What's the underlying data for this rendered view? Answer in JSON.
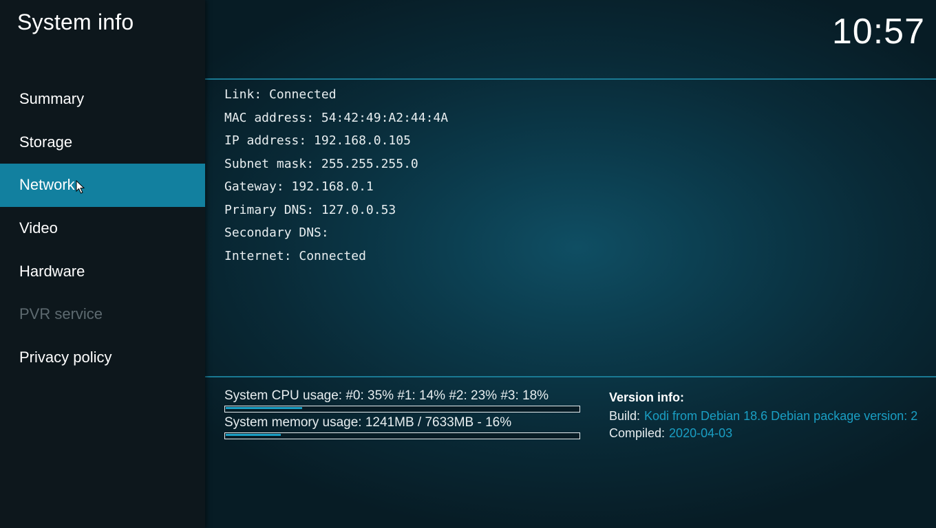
{
  "header": {
    "title": "System info",
    "clock": "10:57"
  },
  "sidebar": {
    "items": [
      {
        "label": "Summary",
        "state": "normal"
      },
      {
        "label": "Storage",
        "state": "normal"
      },
      {
        "label": "Network",
        "state": "active"
      },
      {
        "label": "Video",
        "state": "normal"
      },
      {
        "label": "Hardware",
        "state": "normal"
      },
      {
        "label": "PVR service",
        "state": "disabled"
      },
      {
        "label": "Privacy policy",
        "state": "normal"
      }
    ]
  },
  "network": {
    "rows": [
      "Link: Connected",
      "MAC address: 54:42:49:A2:44:4A",
      "IP address: 192.168.0.105",
      "Subnet mask: 255.255.255.0",
      "Gateway: 192.168.0.1",
      "Primary DNS: 127.0.0.53",
      "Secondary DNS:",
      "Internet: Connected"
    ]
  },
  "usage": {
    "cpu_label": "System CPU usage: #0:  35% #1:  14% #2:  23% #3:  18%",
    "cpu_percent": 22,
    "memory_label": "System memory usage: 1241MB / 7633MB - 16%",
    "memory_percent": 16
  },
  "version": {
    "title": "Version info:",
    "build_label": "Build:",
    "build_value": "Kodi from Debian 18.6 Debian package version: 2",
    "compiled_label": "Compiled:",
    "compiled_value": "2020-04-03"
  },
  "colors": {
    "accent": "#12809f",
    "value_text": "#1a9fc4",
    "disabled_text": "#5d6a70"
  },
  "icons": {
    "cursor": "mouse-pointer-icon"
  }
}
